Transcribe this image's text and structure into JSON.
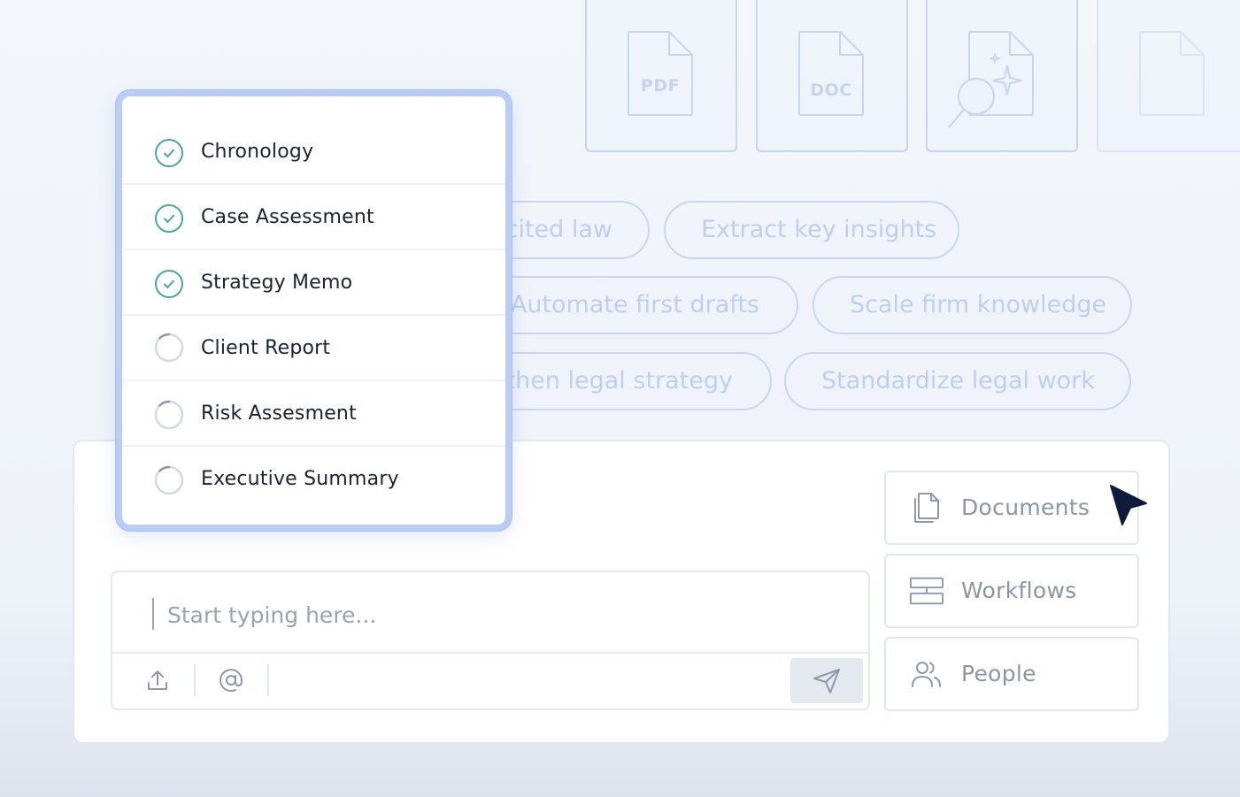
{
  "file_cards": [
    {
      "type_label": "PDF"
    },
    {
      "type_label": "DOC"
    },
    {
      "type_label": ""
    },
    {
      "type_label": ""
    }
  ],
  "chips": [
    "cited law",
    "Extract key insights",
    "Automate first drafts",
    "Scale firm knowledge",
    "then legal strategy",
    "Standardize legal work"
  ],
  "checklist": {
    "items": [
      {
        "label": "Chronology",
        "status": "done"
      },
      {
        "label": "Case Assessment",
        "status": "done"
      },
      {
        "label": "Strategy Memo",
        "status": "done"
      },
      {
        "label": "Client Report",
        "status": "loading"
      },
      {
        "label": "Risk Assesment",
        "status": "loading"
      },
      {
        "label": "Executive Summary",
        "status": "loading"
      }
    ]
  },
  "composer": {
    "placeholder": "Start typing here...",
    "value": ""
  },
  "side_actions": {
    "documents_label": "Documents",
    "workflows_label": "Workflows",
    "people_label": "People"
  },
  "icons": {
    "upload": "upload-icon",
    "mention": "at-sign-icon",
    "send": "send-icon",
    "documents": "documents-icon",
    "workflows": "workflows-icon",
    "people": "people-icon",
    "done": "check-circle-icon",
    "loading": "spinner-icon"
  },
  "colors": {
    "check_green": "#4aa79a",
    "accent_blue": "#b9cdf5",
    "cursor": "#0f1b3d"
  }
}
